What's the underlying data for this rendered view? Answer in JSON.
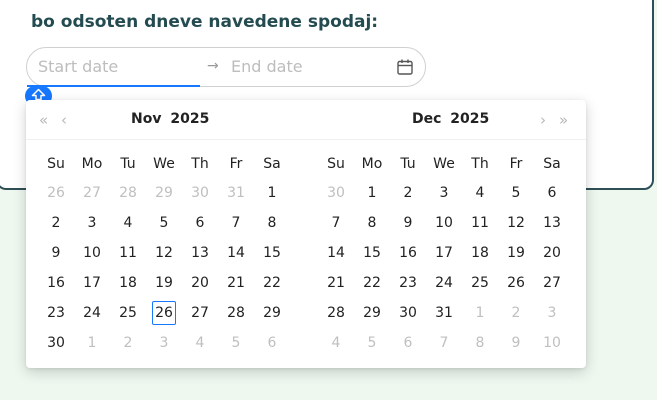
{
  "heading": "bo odsoten dneve navedene spodaj:",
  "range": {
    "start_placeholder": "Start date",
    "separator": "→",
    "end_placeholder": "End date"
  },
  "colors": {
    "accent": "#1677ff",
    "heading": "#244b50",
    "card_border": "#2f4f56"
  },
  "icons": {
    "calendar": "calendar-icon",
    "marker": "arrow-up-icon"
  },
  "weekdays": [
    "Su",
    "Mo",
    "Tu",
    "We",
    "Th",
    "Fr",
    "Sa"
  ],
  "panels": [
    {
      "month": "Nov",
      "year": "2025",
      "nav": [
        "«",
        "‹"
      ],
      "weeks": [
        [
          [
            "26",
            0
          ],
          [
            "27",
            0
          ],
          [
            "28",
            0
          ],
          [
            "29",
            0
          ],
          [
            "30",
            0
          ],
          [
            "31",
            0
          ],
          [
            "1",
            1
          ]
        ],
        [
          [
            "2",
            1
          ],
          [
            "3",
            1
          ],
          [
            "4",
            1
          ],
          [
            "5",
            1
          ],
          [
            "6",
            1
          ],
          [
            "7",
            1
          ],
          [
            "8",
            1
          ]
        ],
        [
          [
            "9",
            1
          ],
          [
            "10",
            1
          ],
          [
            "11",
            1
          ],
          [
            "12",
            1
          ],
          [
            "13",
            1
          ],
          [
            "14",
            1
          ],
          [
            "15",
            1
          ]
        ],
        [
          [
            "16",
            1
          ],
          [
            "17",
            1
          ],
          [
            "18",
            1
          ],
          [
            "19",
            1
          ],
          [
            "20",
            1
          ],
          [
            "21",
            1
          ],
          [
            "22",
            1
          ]
        ],
        [
          [
            "23",
            1
          ],
          [
            "24",
            1
          ],
          [
            "25",
            1
          ],
          [
            "26",
            2
          ],
          [
            "27",
            1
          ],
          [
            "28",
            1
          ],
          [
            "29",
            1
          ]
        ],
        [
          [
            "30",
            1
          ],
          [
            "1",
            0
          ],
          [
            "2",
            0
          ],
          [
            "3",
            0
          ],
          [
            "4",
            0
          ],
          [
            "5",
            0
          ],
          [
            "6",
            0
          ]
        ]
      ]
    },
    {
      "month": "Dec",
      "year": "2025",
      "nav": [
        "›",
        "»"
      ],
      "weeks": [
        [
          [
            "30",
            0
          ],
          [
            "1",
            1
          ],
          [
            "2",
            1
          ],
          [
            "3",
            1
          ],
          [
            "4",
            1
          ],
          [
            "5",
            1
          ],
          [
            "6",
            1
          ]
        ],
        [
          [
            "7",
            1
          ],
          [
            "8",
            1
          ],
          [
            "9",
            1
          ],
          [
            "10",
            1
          ],
          [
            "11",
            1
          ],
          [
            "12",
            1
          ],
          [
            "13",
            1
          ]
        ],
        [
          [
            "14",
            1
          ],
          [
            "15",
            1
          ],
          [
            "16",
            1
          ],
          [
            "17",
            1
          ],
          [
            "18",
            1
          ],
          [
            "19",
            1
          ],
          [
            "20",
            1
          ]
        ],
        [
          [
            "21",
            1
          ],
          [
            "22",
            1
          ],
          [
            "23",
            1
          ],
          [
            "24",
            1
          ],
          [
            "25",
            1
          ],
          [
            "26",
            1
          ],
          [
            "27",
            1
          ]
        ],
        [
          [
            "28",
            1
          ],
          [
            "29",
            1
          ],
          [
            "30",
            1
          ],
          [
            "31",
            1
          ],
          [
            "1",
            0
          ],
          [
            "2",
            0
          ],
          [
            "3",
            0
          ]
        ],
        [
          [
            "4",
            0
          ],
          [
            "5",
            0
          ],
          [
            "6",
            0
          ],
          [
            "7",
            0
          ],
          [
            "8",
            0
          ],
          [
            "9",
            0
          ],
          [
            "10",
            0
          ]
        ]
      ]
    }
  ]
}
